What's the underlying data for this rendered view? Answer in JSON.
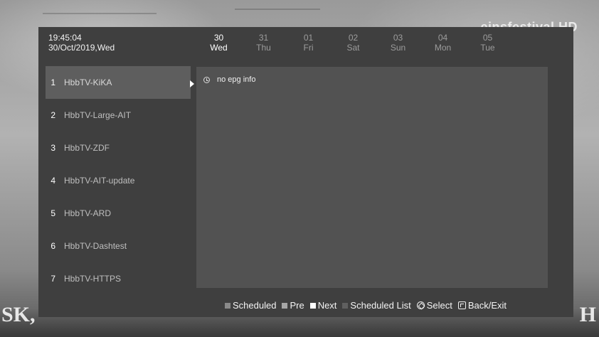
{
  "background": {
    "channel_logo": "einsfestival HD",
    "left_text": "SK,",
    "right_text": "H"
  },
  "clock": {
    "time": "19:45:04",
    "date": "30/Oct/2019,Wed"
  },
  "days": [
    {
      "num": "30",
      "name": "Wed",
      "active": true
    },
    {
      "num": "31",
      "name": "Thu"
    },
    {
      "num": "01",
      "name": "Fri"
    },
    {
      "num": "02",
      "name": "Sat"
    },
    {
      "num": "03",
      "name": "Sun"
    },
    {
      "num": "04",
      "name": "Mon"
    },
    {
      "num": "05",
      "name": "Tue"
    }
  ],
  "channels": [
    {
      "num": "1",
      "name": "HbbTV-KiKA",
      "selected": true
    },
    {
      "num": "2",
      "name": "HbbTV-Large-AIT"
    },
    {
      "num": "3",
      "name": "HbbTV-ZDF"
    },
    {
      "num": "4",
      "name": "HbbTV-AIT-update"
    },
    {
      "num": "5",
      "name": "HbbTV-ARD"
    },
    {
      "num": "6",
      "name": "HbbTV-Dashtest"
    },
    {
      "num": "7",
      "name": "HbbTV-HTTPS"
    }
  ],
  "epg": {
    "message": "no epg info",
    "icon": "clock-icon"
  },
  "legend": {
    "scheduled": "Scheduled",
    "pre": "Pre",
    "next": "Next",
    "scheduled_list": "Scheduled List",
    "select": "Select",
    "back_exit": "Back/Exit"
  }
}
